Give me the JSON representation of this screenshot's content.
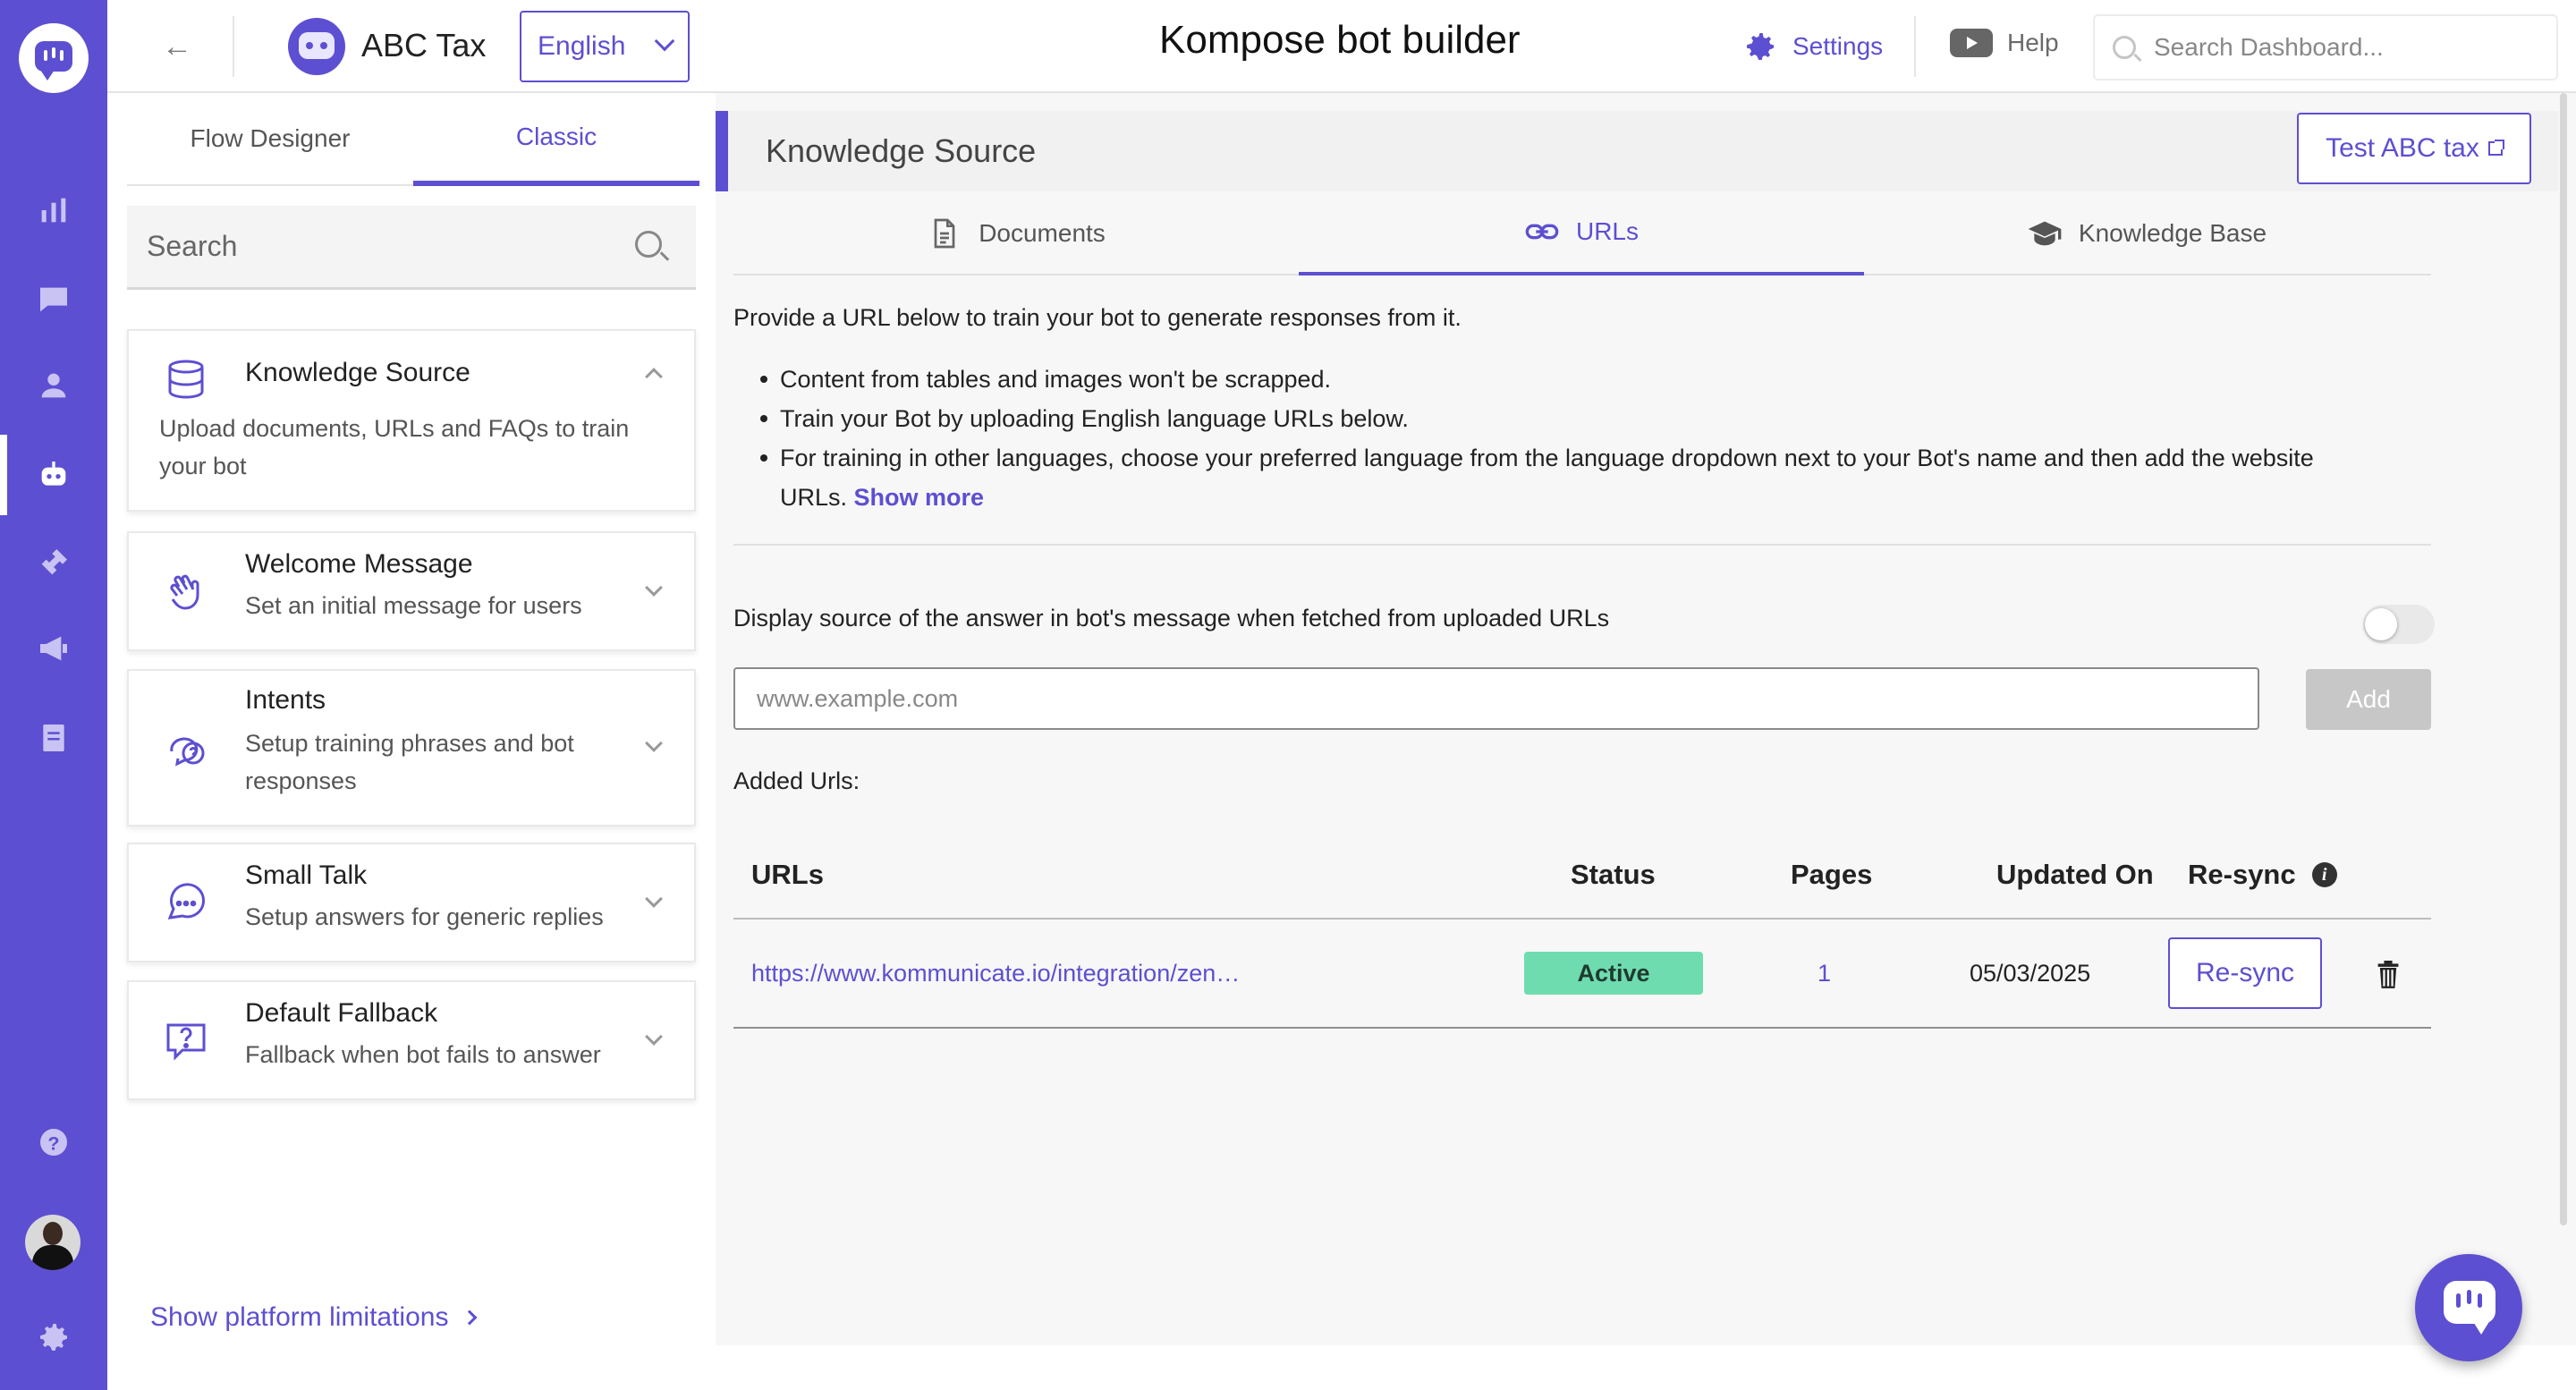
{
  "app": {
    "page_title": "Kompose bot builder",
    "bot_name": "ABC Tax",
    "language": "English",
    "settings_label": "Settings",
    "help_label": "Help",
    "search_placeholder": "Search Dashboard...",
    "accent_color": "#5d4fd1"
  },
  "rail": {
    "items": [
      {
        "name": "analytics",
        "icon": "bar-chart-icon"
      },
      {
        "name": "conversations",
        "icon": "chat-icon"
      },
      {
        "name": "users",
        "icon": "users-icon"
      },
      {
        "name": "bot",
        "icon": "bot-icon",
        "active": true
      },
      {
        "name": "integrations",
        "icon": "plug-icon"
      },
      {
        "name": "campaigns",
        "icon": "megaphone-icon"
      },
      {
        "name": "reports",
        "icon": "document-icon"
      },
      {
        "name": "help",
        "icon": "question-icon"
      },
      {
        "name": "settings",
        "icon": "gear-icon"
      }
    ]
  },
  "left_panel": {
    "tabs": [
      "Flow Designer",
      "Classic"
    ],
    "active_tab": "Classic",
    "search_placeholder": "Search",
    "cards": [
      {
        "title": "Knowledge Source",
        "desc": "Upload documents, URLs and FAQs to train your bot",
        "icon": "database-icon",
        "expanded": true
      },
      {
        "title": "Welcome Message",
        "desc": "Set an initial message for users",
        "icon": "wave-hand-icon"
      },
      {
        "title": "Intents",
        "desc": "Setup training phrases and bot responses",
        "icon": "question-chat-icon"
      },
      {
        "title": "Small Talk",
        "desc": "Setup answers for generic replies",
        "icon": "ellipsis-chat-icon"
      },
      {
        "title": "Default Fallback",
        "desc": "Fallback when bot fails to answer",
        "icon": "question-box-icon"
      }
    ],
    "show_limitations": "Show platform limitations"
  },
  "main": {
    "header": "Knowledge Source",
    "test_button": "Test ABC tax",
    "tabs": [
      "Documents",
      "URLs",
      "Knowledge Base"
    ],
    "active_tab": "URLs",
    "intro": "Provide a URL below to train your bot to generate responses from it.",
    "bullets": [
      "Content from tables and images won't be scrapped.",
      "Train your Bot by uploading English language URLs below.",
      "For training in other languages, choose your preferred language from the language dropdown next to your Bot's name and then add the website URLs."
    ],
    "show_more": "Show more",
    "display_source_label": "Display source of the answer in bot's message when fetched from uploaded URLs",
    "display_source_enabled": false,
    "url_placeholder": "www.example.com",
    "add_button": "Add",
    "added_urls_label": "Added Urls:",
    "table": {
      "headers": {
        "url": "URLs",
        "status": "Status",
        "pages": "Pages",
        "updated": "Updated On",
        "resync": "Re-sync"
      },
      "rows": [
        {
          "url": "https://www.kommunicate.io/integration/zen…",
          "status": "Active",
          "pages": "1",
          "updated": "05/03/2025",
          "action": "Re-sync"
        }
      ]
    }
  }
}
